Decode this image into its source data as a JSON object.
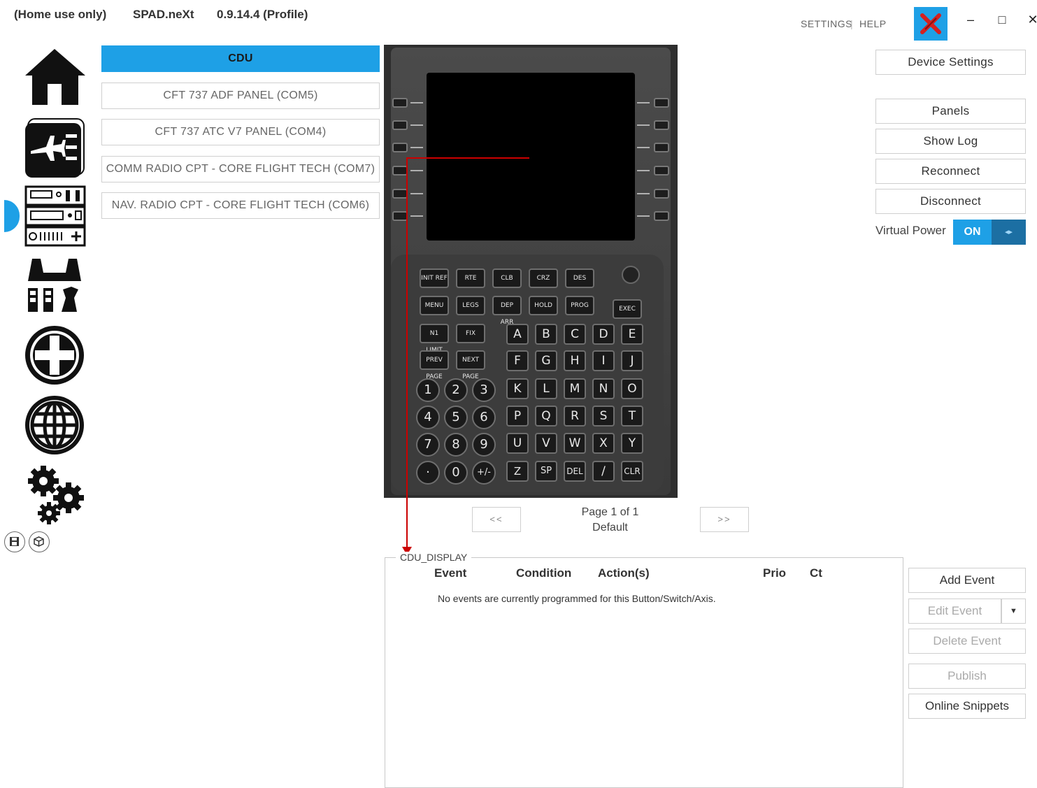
{
  "titlebar": {
    "license": "(Home use only)",
    "app_name": "SPAD.neXt",
    "version": "0.9.14.4 (Profile)",
    "settings_link": "SETTINGS",
    "separator": "|",
    "help_link": "HELP",
    "minimize": "–",
    "maximize": "□",
    "close": "✕"
  },
  "sidebar": {
    "items": [
      {
        "name": "home-icon"
      },
      {
        "name": "flight-profile-icon"
      },
      {
        "name": "devices-icon",
        "active": true
      },
      {
        "name": "controllers-icon"
      },
      {
        "name": "add-device-icon"
      },
      {
        "name": "online-icon"
      },
      {
        "name": "settings-gears-icon"
      }
    ],
    "footer": [
      "save-icon",
      "package-icon"
    ]
  },
  "devices": {
    "items": [
      {
        "label": "CDU",
        "active": true
      },
      {
        "label": "CFT 737 ADF PANEL (COM5)"
      },
      {
        "label": "CFT 737 ATC V7 PANEL (COM4)"
      },
      {
        "label": "COMM RADIO CPT - CORE FLIGHT TECH (COM7)"
      },
      {
        "label": "NAV. RADIO CPT - CORE FLIGHT TECH (COM6)"
      }
    ]
  },
  "cdu": {
    "function_keys_row1": [
      "INIT REF",
      "RTE",
      "CLB",
      "CRZ",
      "DES"
    ],
    "function_keys_row2": [
      "MENU",
      "LEGS",
      "DEP ARR",
      "HOLD",
      "PROG"
    ],
    "exec_key": "EXEC",
    "function_keys_row3": [
      "N1 LIMIT",
      "FIX"
    ],
    "function_keys_row4": [
      "PREV PAGE",
      "NEXT PAGE"
    ],
    "alpha_rows": [
      [
        "A",
        "B",
        "C",
        "D",
        "E"
      ],
      [
        "F",
        "G",
        "H",
        "I",
        "J"
      ],
      [
        "K",
        "L",
        "M",
        "N",
        "O"
      ],
      [
        "P",
        "Q",
        "R",
        "S",
        "T"
      ],
      [
        "U",
        "V",
        "W",
        "X",
        "Y"
      ],
      [
        "Z",
        "SP",
        "DEL",
        "/",
        "CLR"
      ]
    ],
    "numeric_rows": [
      [
        "1",
        "2",
        "3"
      ],
      [
        "4",
        "5",
        "6"
      ],
      [
        "7",
        "8",
        "9"
      ],
      [
        "·",
        "0",
        "+/-"
      ]
    ]
  },
  "paging": {
    "prev": "<<",
    "next": ">>",
    "page_text": "Page 1 of 1",
    "page_name": "Default"
  },
  "right_panel": {
    "device_settings": "Device Settings",
    "panels": "Panels",
    "show_log": "Show Log",
    "reconnect": "Reconnect",
    "disconnect": "Disconnect",
    "virtual_power_label": "Virtual Power",
    "virtual_power_value": "ON",
    "toggle_glyph": "◂▸"
  },
  "events": {
    "group_title": "CDU_DISPLAY",
    "columns": {
      "event": "Event",
      "condition": "Condition",
      "actions": "Action(s)",
      "prio": "Prio",
      "ct": "Ct"
    },
    "empty_message": "No events are currently programmed for this Button/Switch/Axis.",
    "buttons": {
      "add": "Add Event",
      "edit": "Edit Event",
      "edit_dropdown": "▼",
      "delete": "Delete Event",
      "publish": "Publish",
      "snippets": "Online Snippets"
    }
  },
  "colors": {
    "accent": "#1ea0e6",
    "pointer": "#cc0000"
  }
}
